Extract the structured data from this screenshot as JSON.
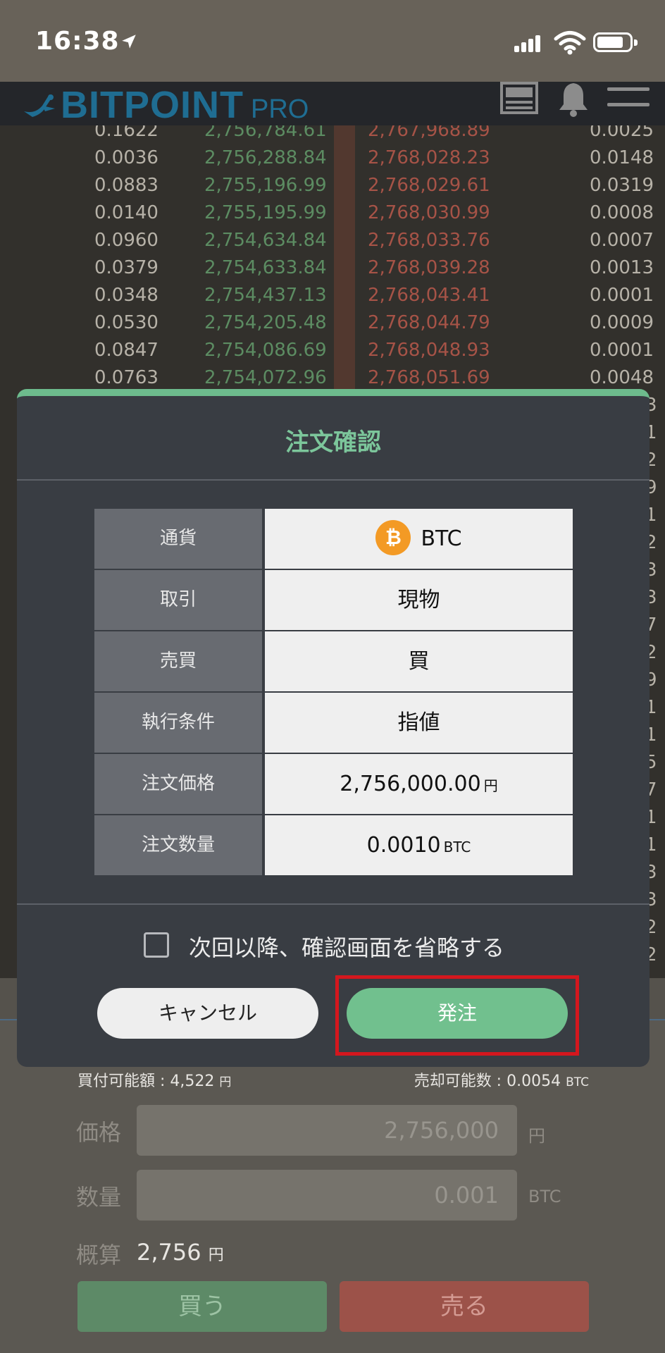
{
  "status_bar": {
    "time": "16:38",
    "icons": [
      "location-arrow-icon",
      "cellular-signal-icon",
      "wifi-icon",
      "battery-icon"
    ]
  },
  "header": {
    "logo_main": "BITPOINT",
    "logo_sub": "PRO",
    "icons": [
      "news-icon",
      "bell-icon",
      "hamburger-menu-icon"
    ]
  },
  "orderbook": {
    "rows": [
      {
        "bid_qty": "0.1622",
        "bid_price": "2,756,784.61",
        "ask_price": "2,767,968.89",
        "ask_qty": "0.0025"
      },
      {
        "bid_qty": "0.0036",
        "bid_price": "2,756,288.84",
        "ask_price": "2,768,028.23",
        "ask_qty": "0.0148"
      },
      {
        "bid_qty": "0.0883",
        "bid_price": "2,755,196.99",
        "ask_price": "2,768,029.61",
        "ask_qty": "0.0319"
      },
      {
        "bid_qty": "0.0140",
        "bid_price": "2,755,195.99",
        "ask_price": "2,768,030.99",
        "ask_qty": "0.0008"
      },
      {
        "bid_qty": "0.0960",
        "bid_price": "2,754,634.84",
        "ask_price": "2,768,033.76",
        "ask_qty": "0.0007"
      },
      {
        "bid_qty": "0.0379",
        "bid_price": "2,754,633.84",
        "ask_price": "2,768,039.28",
        "ask_qty": "0.0013"
      },
      {
        "bid_qty": "0.0348",
        "bid_price": "2,754,437.13",
        "ask_price": "2,768,043.41",
        "ask_qty": "0.0001"
      },
      {
        "bid_qty": "0.0530",
        "bid_price": "2,754,205.48",
        "ask_price": "2,768,044.79",
        "ask_qty": "0.0009"
      },
      {
        "bid_qty": "0.0847",
        "bid_price": "2,754,086.69",
        "ask_price": "2,768,048.93",
        "ask_qty": "0.0001"
      },
      {
        "bid_qty": "0.0763",
        "bid_price": "2,754,072.96",
        "ask_price": "2,768,051.69",
        "ask_qty": "0.0048"
      }
    ],
    "edge_digits": [
      "3",
      "1",
      "2",
      "9",
      "1",
      "2",
      "3",
      "3",
      "7",
      "2",
      "9",
      "1",
      "1",
      "5",
      "7",
      "1",
      "1",
      "3",
      "3",
      "2",
      "2"
    ]
  },
  "modal": {
    "title": "注文確認",
    "rows": [
      {
        "label": "通貨",
        "value": "BTC",
        "unit": "",
        "icon": "bitcoin-coin-icon"
      },
      {
        "label": "取引",
        "value": "現物",
        "unit": ""
      },
      {
        "label": "売買",
        "value": "買",
        "unit": ""
      },
      {
        "label": "執行条件",
        "value": "指値",
        "unit": ""
      },
      {
        "label": "注文価格",
        "value": "2,756,000.00",
        "unit": "円"
      },
      {
        "label": "注文数量",
        "value": "0.0010",
        "unit": "BTC"
      }
    ],
    "coin_symbol": "₿",
    "skip_checkbox_label": "次回以降、確認画面を省略する",
    "skip_checked": false,
    "cancel_label": "キャンセル",
    "order_label": "発注"
  },
  "form": {
    "buy_available_label": "買付可能額 : 4,522",
    "buy_available_unit": "円",
    "sell_available_label": "売却可能数 : 0.0054",
    "sell_available_unit": "BTC",
    "price_label": "価格",
    "price_value": "2,756,000",
    "price_unit": "円",
    "qty_label": "数量",
    "qty_value": "0.001",
    "qty_unit": "BTC",
    "estimate_label": "概算",
    "estimate_value": "2,756",
    "estimate_unit": "円",
    "buy_label": "買う",
    "sell_label": "売る"
  },
  "colors": {
    "accent_green": "#71c08e",
    "bid_green": "#5c8c62",
    "ask_red": "#a65347",
    "highlight_red": "#d4171e",
    "btc_orange": "#f39a25"
  }
}
